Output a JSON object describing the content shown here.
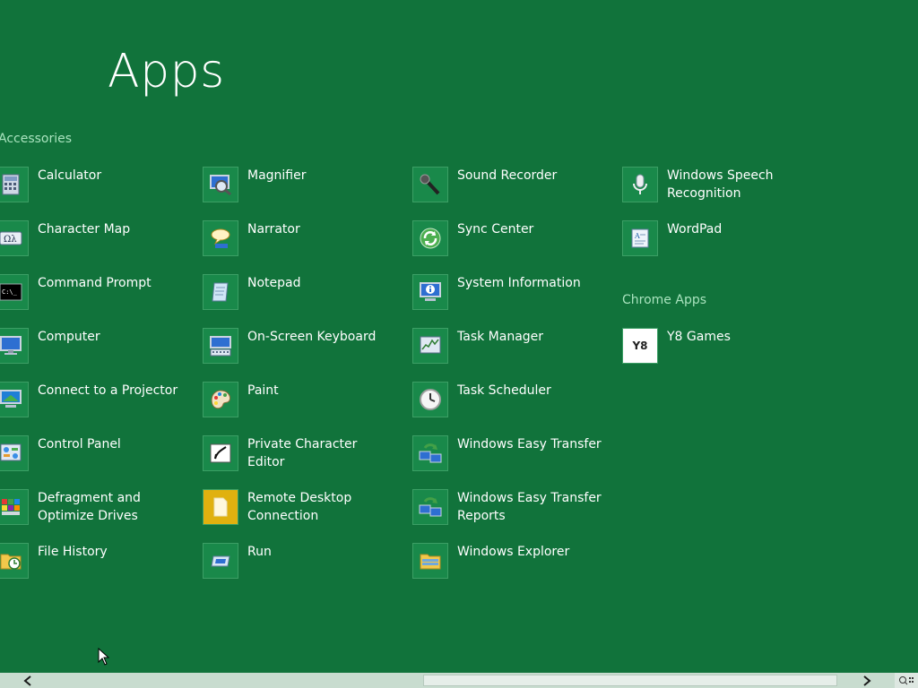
{
  "screen": {
    "title": "Apps"
  },
  "groups": {
    "accessories": {
      "header": "Accessories"
    },
    "chrome": {
      "header": "Chrome Apps"
    }
  },
  "apps": {
    "calculator": "Calculator",
    "character_map": "Character Map",
    "command_prompt": "Command Prompt",
    "computer": "Computer",
    "connect_projector": "Connect to a Projector",
    "control_panel": "Control Panel",
    "defragment": "Defragment and Optimize Drives",
    "file_history": "File History",
    "magnifier": "Magnifier",
    "narrator": "Narrator",
    "notepad": "Notepad",
    "on_screen_keyboard": "On-Screen Keyboard",
    "paint": "Paint",
    "private_char_editor": "Private Character Editor",
    "remote_desktop": "Remote Desktop Connection",
    "run": "Run",
    "sound_recorder": "Sound Recorder",
    "sync_center": "Sync Center",
    "system_information": "System Information",
    "task_manager": "Task Manager",
    "task_scheduler": "Task Scheduler",
    "easy_transfer": "Windows Easy Transfer",
    "easy_transfer_reports": "Windows Easy Transfer Reports",
    "windows_explorer": "Windows Explorer",
    "speech_recognition": "Windows Speech Recognition",
    "wordpad": "WordPad",
    "y8_games": "Y8 Games"
  },
  "icons": {
    "calculator": "calculator-icon",
    "character_map": "character-map-icon",
    "command_prompt": "command-prompt-icon",
    "computer": "computer-icon",
    "connect_projector": "projector-icon",
    "control_panel": "control-panel-icon",
    "defragment": "defragment-icon",
    "file_history": "file-history-icon",
    "magnifier": "magnifier-icon",
    "narrator": "narrator-icon",
    "notepad": "notepad-icon",
    "on_screen_keyboard": "keyboard-icon",
    "paint": "paint-palette-icon",
    "private_char_editor": "private-character-editor-icon",
    "remote_desktop": "remote-desktop-icon",
    "run": "run-icon",
    "sound_recorder": "microphone-icon",
    "sync_center": "sync-icon",
    "system_information": "system-information-icon",
    "task_manager": "task-manager-icon",
    "task_scheduler": "clock-icon",
    "easy_transfer": "easy-transfer-icon",
    "easy_transfer_reports": "easy-transfer-reports-icon",
    "windows_explorer": "folder-icon",
    "speech_recognition": "speech-microphone-icon",
    "wordpad": "wordpad-icon",
    "y8_games": "y8-logo-icon",
    "scroll_left": "chevron-left-icon",
    "scroll_right": "chevron-right-icon",
    "zoom": "semantic-zoom-icon",
    "cursor": "mouse-pointer-icon"
  },
  "y8_logo_text": "Y8",
  "colors": {
    "background": "#11733b",
    "tile": "#19894a",
    "group_header": "#a9e3be",
    "scrollbar_track": "#c8dccf"
  }
}
